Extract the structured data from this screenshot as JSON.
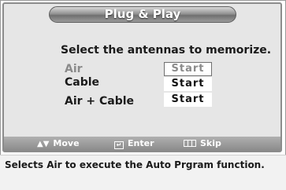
{
  "dialog": {
    "title": "Plug & Play",
    "heading": "Select the antennas to memorize."
  },
  "options": [
    {
      "label": "Air",
      "button": "Start",
      "selected": true
    },
    {
      "label": "Cable",
      "button": "Start",
      "selected": false
    },
    {
      "label": "Air + Cable",
      "button": "Start",
      "selected": false
    }
  ],
  "hints": {
    "move": {
      "icon": "up-down-arrows-icon",
      "label": "Move"
    },
    "enter": {
      "icon": "enter-icon",
      "label": "Enter"
    },
    "skip": {
      "icon": "skip-icon",
      "label": "Skip"
    }
  },
  "description": "Selects Air to execute the Auto Prgram function."
}
